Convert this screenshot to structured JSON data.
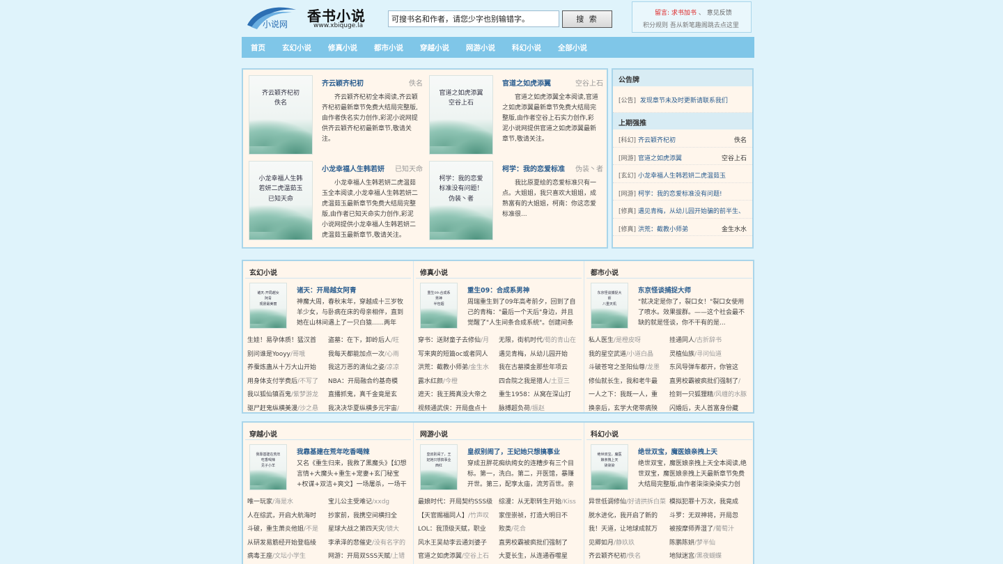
{
  "header": {
    "logo_small": "小说网",
    "brand": "香书小说",
    "domain": "www.xbiquge.la",
    "search_placeholder": "可搜书名和作者，请您少字也别输错字。",
    "search_button": "搜 索",
    "notice_prefix": "留言:",
    "notice_link1": "求书加书",
    "notice_link2": "意见反馈",
    "notice_line2": "积分规则   吾从新笔趣阁跳去点这里"
  },
  "nav": [
    "首页",
    "玄幻小说",
    "修真小说",
    "都市小说",
    "穿越小说",
    "网游小说",
    "科幻小说",
    "全部小说"
  ],
  "featured": [
    {
      "title": "齐云颖齐杞初",
      "author": "佚名",
      "desc": "齐云颖齐杞初全本阅读,齐云颖齐杞初最新章节免费大结局完整版,由作者佚名实力创作,彩泥小说网提供齐云颖齐杞初最新章节,敬请关注。",
      "cover": "齐云颖齐杞初\n佚名"
    },
    {
      "title": "官道之如虎添翼",
      "author": "空谷上石",
      "desc": "官道之如虎添翼全本阅读,官道之如虎添翼最新章节免费大结局完整版,由作者空谷上石实力创作,彩泥小说网提供官道之如虎添翼最新章节,敬请关注。",
      "cover": "官道之如虎添翼\n空谷上石"
    },
    {
      "title": "小龙幸福人生韩若妍",
      "author": "已知天命",
      "desc": "小龙幸福人生韩若妍二虎温茹玉全本阅读,小龙幸福人生韩若妍二虎温茹玉最新章节免费大结局完整版,由作者已知天命实力创作,彩泥小说网提供小龙幸福人生韩若妍二虎温茹玉最新章节,敬请关注。",
      "cover": "小龙幸福人生韩\n若妍二虎温茹玉\n已知天命"
    },
    {
      "title": "柯学：我的恋爱标准",
      "author": "伪装丶者",
      "desc": "我比原夏绘的恋爱标准只有一点。大姐姐，我只喜欢大姐姐，成熟富有的大姐姐，柯南：你这恋爱标准很...",
      "cover": "柯学：我的恋爱\n标准没有问题！\n伪装丶者"
    }
  ],
  "sidebar": {
    "notice_title": "公告牌",
    "notice_tag": "[公告]",
    "notice_text": "发现章节未及时更新请联系我们",
    "rank_title": "上期强推",
    "rank": [
      {
        "tag": "[科幻]",
        "title": "齐云颖齐杞初",
        "author": "佚名"
      },
      {
        "tag": "[网游]",
        "title": "官道之如虎添翼",
        "author": "空谷上石"
      },
      {
        "tag": "[玄幻]",
        "title": "小龙幸福人生韩若妍二虎温茹玉",
        "author": ""
      },
      {
        "tag": "[网游]",
        "title": "柯学：我的恋爱标准没有问题!",
        "author": ""
      },
      {
        "tag": "[修真]",
        "title": "遇见青梅，从幼儿园开始骗的前半生、",
        "author": ""
      },
      {
        "tag": "[修真]",
        "title": "洪荒：截教小师弟",
        "author": "金生水水"
      }
    ]
  },
  "categories_row1": [
    {
      "name": "玄幻小说",
      "top_title": "诸天：开局越女阿青",
      "top_desc": "神魔大周，春秋末年，穿越成十三岁牧羊少女，与卧病在床的母亲相伴，直到她在山林间遇上了一只白猿......两年后，赵青",
      "cover": "诸天:开局越女\n阿青\n观景最美丽",
      "list": [
        {
          "t": "生娃！易孕体质！猛汉首",
          "a": ""
        },
        {
          "t": "盗墓：在下，卸岭后人",
          "a": "/旺"
        },
        {
          "t": "别问谁是Yooyy",
          "a": "/哥哦"
        },
        {
          "t": "我每天都能加点一次",
          "a": "/心雨"
        },
        {
          "t": "养蚕炼蛊从十万大山开始",
          "a": ""
        },
        {
          "t": "我这万恶的滴仙之姿",
          "a": "/凉凉"
        },
        {
          "t": "用身体支付学费后",
          "a": "/不写了"
        },
        {
          "t": "NBA：开局融合约基奇模",
          "a": ""
        },
        {
          "t": "我以狐仙镇百鬼",
          "a": "/紫梦游龙"
        },
        {
          "t": "直播抓鬼，真千金竟是玄",
          "a": ""
        },
        {
          "t": "驱尸赶鬼纵横美漫",
          "a": "/沙之悬"
        },
        {
          "t": "我决决华夏纵横多元宇宙",
          "a": "/"
        }
      ]
    },
    {
      "name": "修真小说",
      "top_title": "重生09：合成系男神",
      "top_desc": "周瑞重生到了09年高考前夕，回到了自己的青梅：\"最后一个天后\"身边，并且觉醒了\"人生间条合成系统\"。创建间条任务，",
      "cover": "重生09:合成系\n男神\n半包烟",
      "list": [
        {
          "t": "穿书：送财童子去修仙",
          "a": "/月"
        },
        {
          "t": "无限，街机时代",
          "a": "/荀的青山在"
        },
        {
          "t": "写来爽的短篇oc或者同人",
          "a": ""
        },
        {
          "t": "遇见青梅，从幼儿园开始",
          "a": ""
        },
        {
          "t": "洪荒：截教小师弟",
          "a": "/金生水"
        },
        {
          "t": "我在古墓摸金那些年项云",
          "a": ""
        },
        {
          "t": "露水红颜",
          "a": "/今橙"
        },
        {
          "t": "四合院之我是猎人",
          "a": "/土豆三"
        },
        {
          "t": "遮天：我王腾真没大帝之",
          "a": ""
        },
        {
          "t": "重生1958：从窝在深山打",
          "a": ""
        },
        {
          "t": "视频通武侠：开局盘点十",
          "a": ""
        },
        {
          "t": "脉搏超负荷",
          "a": "/振赵"
        }
      ]
    },
    {
      "name": "都市小说",
      "top_title": "东京怪谈捕捉大师",
      "top_desc": "\"就决定是你了，裂口女！\"裂口女使用了喷水。效果拔群。——这个社会最不缺的就是怪谈，你不干有的是...",
      "cover": "东京怪谈捕捉大\n师\n八重天机",
      "list": [
        {
          "t": "私人医生",
          "a": "/是橙皮呀"
        },
        {
          "t": "挂通同人",
          "a": "/古折辞书"
        },
        {
          "t": "我的星空武道",
          "a": "/小道白晶"
        },
        {
          "t": "灵植仙族",
          "a": "/寻问仙道"
        },
        {
          "t": "斗破苍穹之圣阳仙尊",
          "a": "/龙墨"
        },
        {
          "t": "东风导弹车都开，你管这",
          "a": ""
        },
        {
          "t": "修仙就长生，我和老牛最",
          "a": ""
        },
        {
          "t": "直男校霸被疯批们强制了",
          "a": "/"
        },
        {
          "t": "一人之下：我既一人，重",
          "a": ""
        },
        {
          "t": "捡到一只狐狸精",
          "a": "/风缠的水豚"
        },
        {
          "t": "换亲后，玄学大佬带病殃",
          "a": ""
        },
        {
          "t": "闪婚后，夫人首富身份藏",
          "a": ""
        }
      ]
    }
  ],
  "categories_row2": [
    {
      "name": "穿越小说",
      "top_title": "我靠基建在荒年吃香喝辣",
      "top_desc": "又名《重生归来，我救了黑魔头》【幻想言情+大魔头+重生+宠妻+玄门秘宝+权谋+双洁+爽文】一场屠杀，一场干旱，一场",
      "cover": "我靠基建在荒年\n吃香喝辣\n见子小羊",
      "list": [
        {
          "t": "唯一玩家",
          "a": "/海是水"
        },
        {
          "t": "宝儿公主受难记",
          "a": "/xxdg"
        },
        {
          "t": "人在综武，开启大航海时",
          "a": ""
        },
        {
          "t": "抄家前，我携空间横扫全",
          "a": ""
        },
        {
          "t": "斗破，重生萧炎他姐",
          "a": "/不是"
        },
        {
          "t": "星球大战之第四天灾",
          "a": "/镜大"
        },
        {
          "t": "从研发易筋经开始登临绫",
          "a": ""
        },
        {
          "t": "李承泽的悲催史",
          "a": "/没有名字的"
        },
        {
          "t": "病毒王座",
          "a": "/文坛小学生"
        },
        {
          "t": "网游：开局双SSS天赋",
          "a": "/上错"
        }
      ]
    },
    {
      "name": "网游小说",
      "top_title": "皇叔别闹了，王妃她只想搞事业",
      "top_desc": "穿成丑胖花痴纨绔女的连糟步有三个目标。第一，洗白。第二，开医馆，暴赚开世。第三，配享太庙，流芳百世。亲何她",
      "cover": "皇叔别闹了，王\n妃她只想搞事业\n西红",
      "list": [
        {
          "t": "最娘时代：开局契约SSS级",
          "a": ""
        },
        {
          "t": "综漫：从无职转生开始",
          "a": "/Kiss"
        },
        {
          "t": "【天官赐福同人】",
          "a": "/竹声叹"
        },
        {
          "t": "家侄崇祯，打造大明日不",
          "a": ""
        },
        {
          "t": "LOL：我顶级天赋，职业",
          "a": ""
        },
        {
          "t": "败类",
          "a": "/花合"
        },
        {
          "t": "风水王吴劫李云通刘婆子",
          "a": ""
        },
        {
          "t": "直男校霸被疯批们强制了",
          "a": ""
        },
        {
          "t": "官道之如虎添翼",
          "a": "/空谷上石"
        },
        {
          "t": "大夏长生，从连通吞噬星",
          "a": ""
        }
      ]
    },
    {
      "name": "科幻小说",
      "top_title": "绝世双宝，魔医娘亲拽上天",
      "top_desc": "绝世双宝，魔医娘亲拽上天全本阅读,绝世双宝，魔医娘亲拽上天最新章节免费大结局完整版,由作者柒柒染染实力创作,彩泥小",
      "cover": "绝世双宝，魔医\n娘亲拽上天\n柒柒染",
      "list": [
        {
          "t": "异世低调修仙",
          "a": "/好请拱拆白菜"
        },
        {
          "t": "模拟犯罪十万次，我竟成",
          "a": ""
        },
        {
          "t": "脱水进化，我开启了新的",
          "a": ""
        },
        {
          "t": "斗罗：无双神将，开局忽",
          "a": ""
        },
        {
          "t": "我！天道，让地球成就万",
          "a": ""
        },
        {
          "t": "被按摩师弄湿了",
          "a": "/葡萄汁"
        },
        {
          "t": "见卿如月",
          "a": "/静玖玖"
        },
        {
          "t": "陈鹏陈妍",
          "a": "/梦半仙"
        },
        {
          "t": "齐云颖齐杞初",
          "a": "/佚名"
        },
        {
          "t": "地狱迷宫",
          "a": "/黑夜蝴蝶"
        }
      ]
    }
  ],
  "colors": {
    "nav_bg": "#7fc6e8",
    "panel_bg": "#fff6ec",
    "border": "#a9d5ea",
    "link": "#2a5d8f",
    "page_bg": "#dff3fb"
  }
}
